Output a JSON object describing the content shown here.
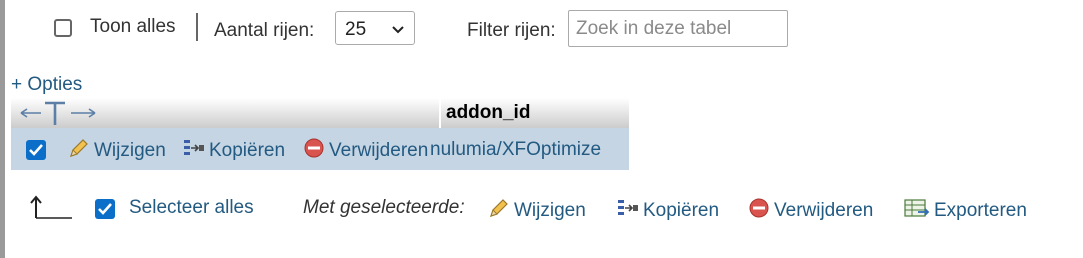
{
  "topbar": {
    "show_all_label": "Toon alles",
    "rows_label": "Aantal rijen:",
    "rows_value": "25",
    "filter_label": "Filter rijen:",
    "filter_placeholder": "Zoek in deze tabel"
  },
  "options_label": "+ Opties",
  "table": {
    "columns": [
      "addon_id"
    ],
    "rows": [
      {
        "checked": true,
        "actions": [
          "Wijzigen",
          "Kopiëren",
          "Verwijderen"
        ],
        "values": [
          "nulumia/XFOptimize"
        ]
      }
    ]
  },
  "footer": {
    "select_all_label": "Selecteer alles",
    "with_selected_label": "Met geselecteerde:",
    "actions": [
      "Wijzigen",
      "Kopiëren",
      "Verwijderen",
      "Exporteren"
    ]
  },
  "colors": {
    "link": "#235a81",
    "row_highlight": "#c5d5e4",
    "checkbox": "#0b6fc9",
    "delete_icon": "#d9534f"
  },
  "icons": {
    "edit": "pencil-icon",
    "copy": "copy-icon",
    "delete": "delete-icon",
    "export": "export-icon",
    "column_arrows": "column-arrows-icon",
    "select_arrow": "arrow-up-icon"
  }
}
